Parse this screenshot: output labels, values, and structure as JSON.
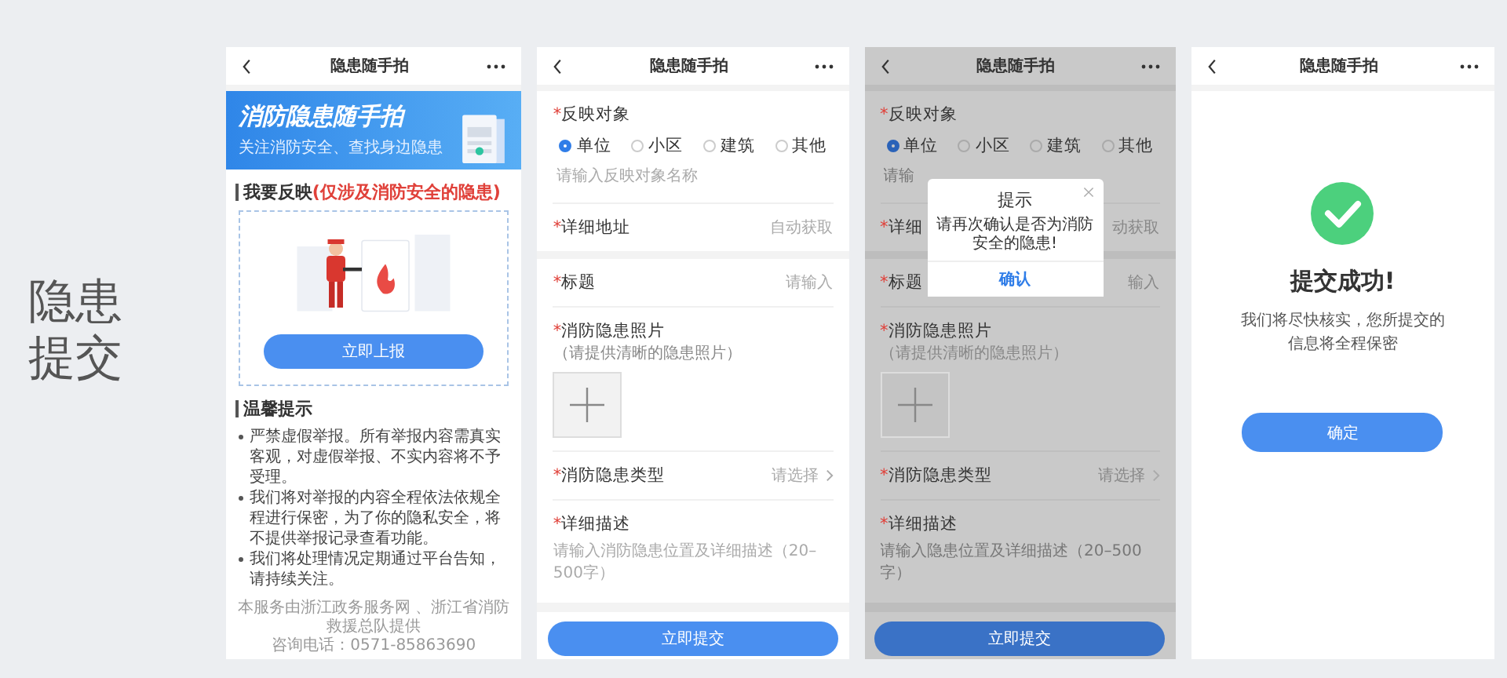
{
  "slide_title": "隐患提交",
  "screens": [
    {
      "kind": "home",
      "nav": {
        "title": "隐患随手拍"
      },
      "banner": {
        "title": "消防隐患随手拍",
        "subtitle": "关注消防安全、查找身边隐患"
      },
      "report": {
        "heading": "我要反映",
        "highlight": "(仅涉及消防安全的隐患)",
        "button": "立即上报"
      },
      "tips": {
        "heading": "温馨提示",
        "items": [
          "严禁虚假举报。所有举报内容需真实客观，对虚假举报、不实内容将不予受理。",
          "我们将对举报的内容全程依法依规全程进行保密，为了你的隐私安全，将不提供举报记录查看功能。",
          "我们将处理情况定期通过平台告知，请持续关注。"
        ]
      },
      "footer": [
        "本服务由浙江政务服务网 、浙江省消防救援总队提供",
        "咨询电话：0571-85863690"
      ]
    },
    {
      "kind": "form",
      "dimmed": false,
      "nav": {
        "title": "隐患随手拍"
      },
      "sections": [
        [
          {
            "kind": "choice",
            "mark": "*",
            "label": "反映对象",
            "options": [
              {
                "label": "单位",
                "selected": true
              },
              {
                "label": "小区",
                "selected": false
              },
              {
                "label": "建筑",
                "selected": false
              },
              {
                "label": "其他",
                "selected": false
              }
            ],
            "placeholder": "请输入反映对象名称"
          },
          {
            "kind": "text",
            "mark": "*",
            "label": "详细地址",
            "hint": "自动获取"
          }
        ],
        [
          {
            "kind": "text",
            "mark": "*",
            "label": "标题",
            "hint": "请输入"
          },
          {
            "kind": "photo",
            "mark": "*",
            "label": "消防隐患照片",
            "hint": "（请提供清晰的隐患照片）"
          },
          {
            "kind": "select",
            "mark": "*",
            "label": "消防隐患类型",
            "hint": "请选择"
          },
          {
            "kind": "textarea",
            "mark": "*",
            "label": "详细描述",
            "placeholder": "请输入消防隐患位置及详细描述（20–500字）"
          }
        ]
      ],
      "submit": "立即提交"
    },
    {
      "kind": "form",
      "dimmed": true,
      "nav": {
        "title": "隐患随手拍"
      },
      "sections": [
        [
          {
            "kind": "choice",
            "mark": "*",
            "label": "反映对象",
            "options": [
              {
                "label": "单位",
                "selected": true
              },
              {
                "label": "小区",
                "selected": false
              },
              {
                "label": "建筑",
                "selected": false
              },
              {
                "label": "其他",
                "selected": false
              }
            ],
            "placeholder": "请输"
          },
          {
            "kind": "text",
            "mark": "*",
            "label": "详细",
            "hint": "动获取"
          }
        ],
        [
          {
            "kind": "text",
            "mark": "*",
            "label": "标题",
            "hint": "输入"
          },
          {
            "kind": "photo",
            "mark": "*",
            "label": "消防隐患照片",
            "hint": "（请提供清晰的隐患照片）"
          },
          {
            "kind": "select",
            "mark": "*",
            "label": "消防隐患类型",
            "hint": "请选择"
          },
          {
            "kind": "textarea",
            "mark": "*",
            "label": "详细描述",
            "placeholder": "请输入隐患位置及详细描述（20–500字）"
          }
        ]
      ],
      "dialog": {
        "title": "提示",
        "message": "请再次确认是否为消防安全的隐患!",
        "button": "确认"
      },
      "submit": "立即提交"
    },
    {
      "kind": "success",
      "nav": {
        "title": "隐患随手拍"
      },
      "title": "提交成功!",
      "message": [
        "我们将尽快核实，您所提交的",
        "信息将全程保密"
      ],
      "button": "确定"
    }
  ]
}
